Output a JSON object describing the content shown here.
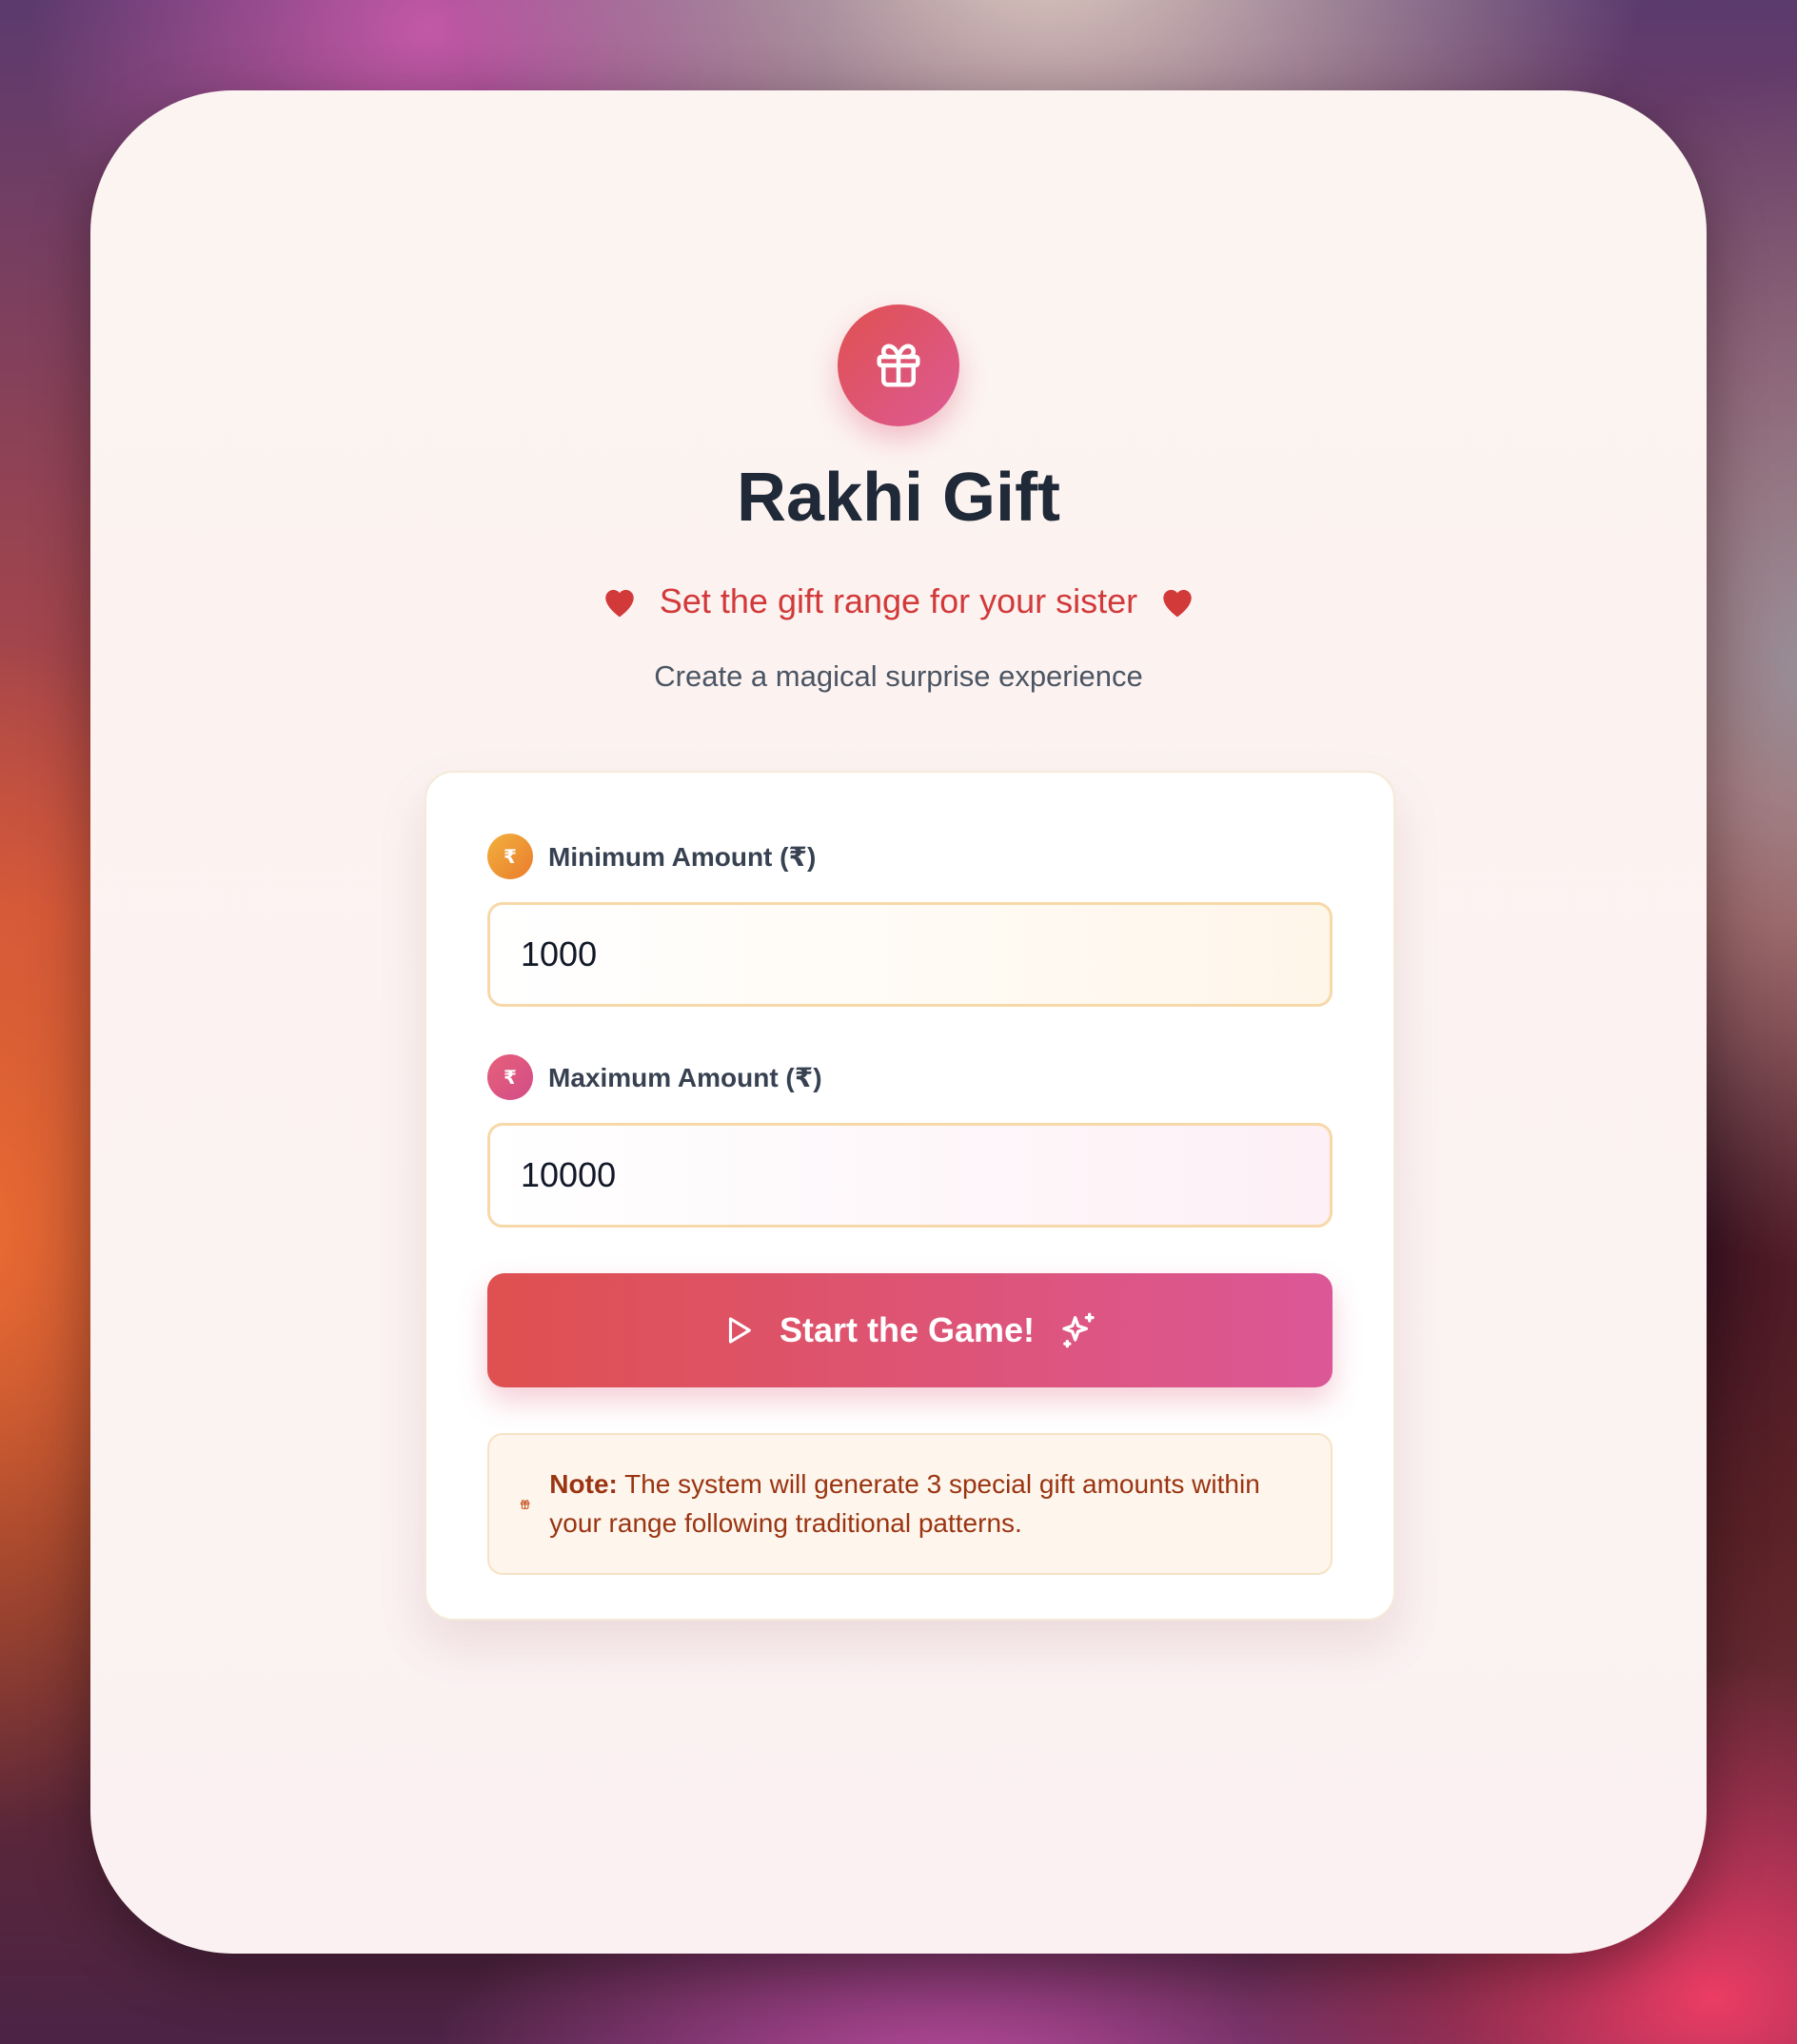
{
  "app": {
    "title": "Rakhi Gift",
    "tagline": "Set the gift range for your sister",
    "subtitle": "Create a magical surprise experience"
  },
  "icons": {
    "badge": "gift-icon",
    "tagline_left": "heart-icon",
    "tagline_right": "heart-icon",
    "start_left": "play-icon",
    "start_right": "sparkles-icon",
    "note": "gift-icon"
  },
  "form": {
    "min": {
      "coin_symbol": "₹",
      "label": "Minimum Amount (₹)",
      "value": "1000"
    },
    "max": {
      "coin_symbol": "₹",
      "label": "Maximum Amount (₹)",
      "value": "10000"
    },
    "start_label": "Start the Game!"
  },
  "note": {
    "prefix": "Note:",
    "text": "The system will generate 3 special gift amounts within your range following traditional patterns."
  },
  "colors": {
    "accent_start": "#df5050",
    "accent_end": "#dc5797",
    "heart": "#d23a3a",
    "title": "#1f2937",
    "note_text": "#9a3412"
  }
}
